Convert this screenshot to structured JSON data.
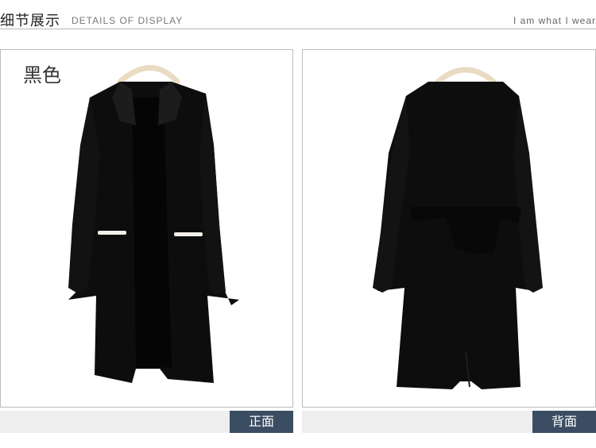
{
  "header": {
    "title_cn": "细节展示",
    "title_en": "DETAILS OF DISPLAY",
    "slogan": "I am what I wear"
  },
  "panels": {
    "front": {
      "color_label": "黑色",
      "view_tag": "正面"
    },
    "back": {
      "view_tag": "背面"
    }
  },
  "colors": {
    "garment": "#0d0d0d",
    "trim": "#f2efe8",
    "hanger": "#e9dcc3",
    "tag_bg": "#3b4d63",
    "caption_bar": "#eeeeee",
    "border": "#bdbdbd"
  }
}
